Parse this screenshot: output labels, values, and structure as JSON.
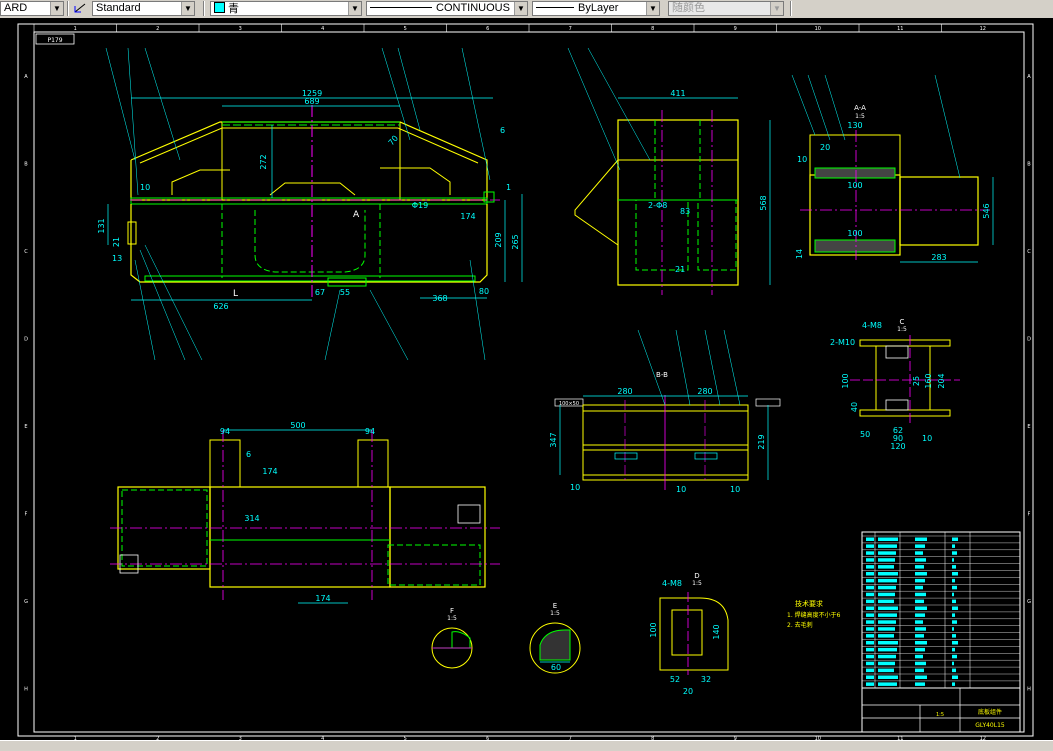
{
  "toolbar": {
    "text_style_partial": "ARD",
    "dim_style": "Standard",
    "color": "青",
    "linetype": "CONTINUOUS",
    "lineweight": "ByLayer",
    "plotstyle": "随颜色"
  },
  "drawing": {
    "top_left_tag": "P179",
    "grid_cols": [
      "1",
      "2",
      "3",
      "4",
      "5",
      "6",
      "7",
      "8",
      "9",
      "10",
      "11",
      "12"
    ],
    "grid_rows": [
      "A",
      "B",
      "C",
      "D",
      "E",
      "F",
      "G",
      "H"
    ],
    "main_view": {
      "d_1259": "1259",
      "d_689": "689",
      "d_272": "272",
      "d_70": "70",
      "d_131": "131",
      "d_21": "21",
      "d_13": "13",
      "d_626": "626",
      "d_67": "67",
      "d_55": "55",
      "d_368": "368",
      "d_80": "80",
      "d_174": "174",
      "d_209": "209",
      "d_265": "265",
      "d_619": "Φ19",
      "d_6": "6",
      "d_1": "1",
      "sec_a": "A",
      "sec_l": "L",
      "d_10": "10"
    },
    "right_view": {
      "d_411": "411",
      "d_568": "568",
      "d_83": "83",
      "d_21": "21",
      "label": "2-Φ8"
    },
    "section_aa": {
      "title": "A-A",
      "scale": "1:5",
      "d_130": "130",
      "d_100a": "100",
      "d_100b": "100",
      "d_546": "546",
      "d_283": "283",
      "d_14": "14",
      "d_10": "10",
      "d_20": "20"
    },
    "section_bb": {
      "title": "B-B",
      "d_280a": "280",
      "d_280b": "280",
      "d_347": "347",
      "d_219": "219",
      "d_10a": "10",
      "d_10b": "10",
      "d_10c": "10",
      "tag": "100×50"
    },
    "detail_c": {
      "title": "C",
      "scale": "1:5",
      "label_m10": "2-M10",
      "label_m8": "4-M8",
      "d_100": "100",
      "d_160": "160",
      "d_204": "204",
      "d_62": "62",
      "d_90": "90",
      "d_120": "120",
      "d_10": "10",
      "d_50": "50",
      "d_40": "40",
      "d_25": "25"
    },
    "bottom_view": {
      "d_500": "500",
      "d_94a": "94",
      "d_94b": "94",
      "d_6": "6",
      "d_174a": "174",
      "d_174b": "174",
      "d_314": "314"
    },
    "detail_d": {
      "title": "D",
      "scale": "1:5",
      "label": "4-M8",
      "d_100": "100",
      "d_140": "140",
      "d_52": "52",
      "d_32": "32",
      "d_20": "20"
    },
    "detail_e": {
      "title": "E",
      "scale": "1:5",
      "d_60": "60"
    },
    "detail_f": {
      "title": "F",
      "scale": "1:5"
    },
    "notes": {
      "title": "技术要求",
      "line1": "1. 焊缝高度不小于6",
      "line2": "2. 去毛刺"
    },
    "title_block": {
      "drawing_no": "GLY40L15",
      "name": "底板组件",
      "scale": "1:5"
    }
  },
  "colors": {
    "background": "#000000",
    "yellow": "#ffff00",
    "green": "#00ff00",
    "cyan": "#00ffff",
    "magenta": "#ff00ff",
    "white": "#ffffff",
    "red": "#ff0000"
  }
}
